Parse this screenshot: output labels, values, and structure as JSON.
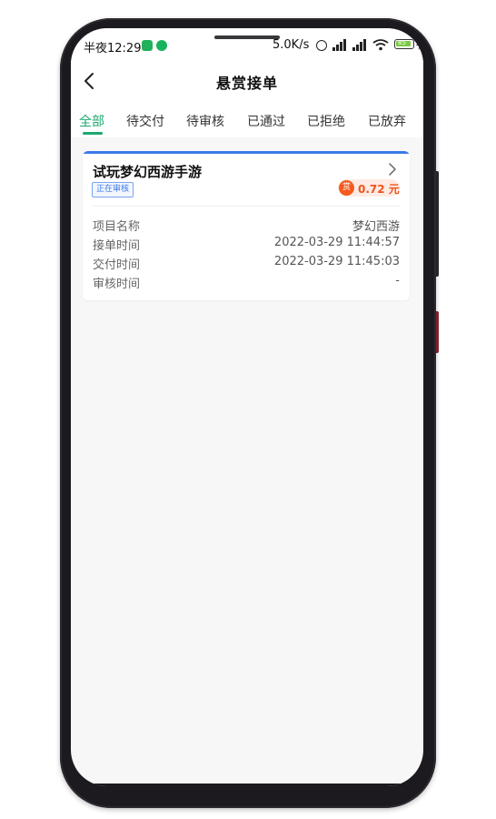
{
  "status_bar": {
    "time": "半夜12:29",
    "speed": "5.0K/s",
    "battery_level": "85"
  },
  "header": {
    "title": "悬赏接单"
  },
  "tabs": [
    {
      "label": "全部",
      "active": true
    },
    {
      "label": "待交付",
      "active": false
    },
    {
      "label": "待审核",
      "active": false
    },
    {
      "label": "已通过",
      "active": false
    },
    {
      "label": "已拒绝",
      "active": false
    },
    {
      "label": "已放弃",
      "active": false
    }
  ],
  "order_card": {
    "title": "试玩梦幻西游手游",
    "status": "正在审核",
    "reward_icon_text": "赏",
    "reward_amount": "0.72 元",
    "fields": [
      {
        "label": "项目名称",
        "value": "梦幻西游"
      },
      {
        "label": "接单时间",
        "value": "2022-03-29 11:44:57"
      },
      {
        "label": "交付时间",
        "value": "2022-03-29 11:45:03"
      },
      {
        "label": "审核时间",
        "value": "-"
      }
    ]
  },
  "colors": {
    "accent": "#1ca86e",
    "card_accent": "#3b7ae8",
    "reward": "#f0541b"
  }
}
